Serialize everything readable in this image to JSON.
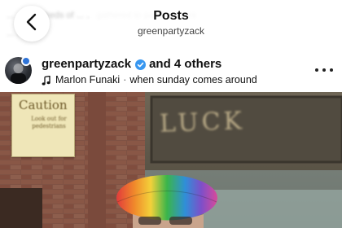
{
  "header": {
    "title": "Posts",
    "subtitle": "greenpartyzack",
    "blurred_caption": [
      "... ... hundreds of ... ... gathered to party ... more",
      "... ... ago"
    ]
  },
  "post": {
    "username": "greenpartyzack",
    "collaborators": "and 4 others",
    "music": {
      "artist": "Marlon Funaki",
      "separator": "·",
      "track": "when sunday comes around"
    }
  },
  "photo": {
    "sign_title": "Caution",
    "sign_body": "Look out for pedestrians",
    "shop_sign": "LUCK"
  },
  "colors": {
    "verified": "#3897f0",
    "story_ring": "#2f74d8",
    "brick": "#8a5a4a"
  },
  "icons": [
    "chevron-left-icon",
    "verified-badge-icon",
    "music-note-icon",
    "more-options-icon"
  ]
}
